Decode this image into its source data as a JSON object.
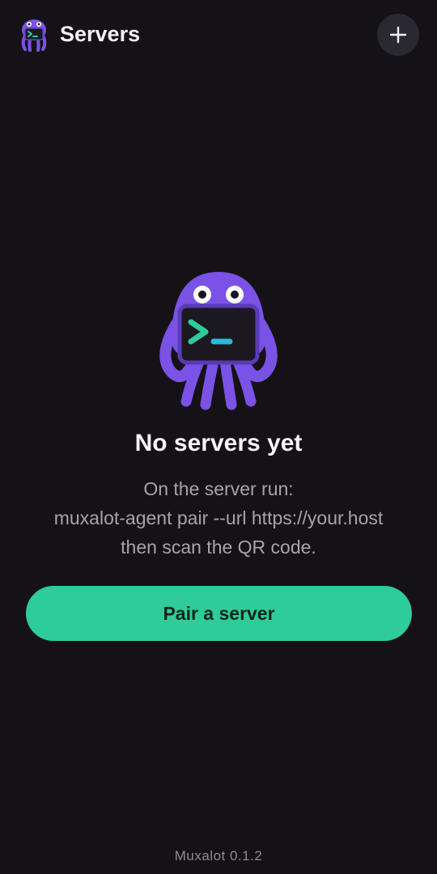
{
  "header": {
    "title": "Servers",
    "logo_icon": "octopus-terminal-logo",
    "add_icon": "plus-icon"
  },
  "empty_state": {
    "mascot_icon": "octopus-terminal-mascot",
    "title": "No servers yet",
    "description_lines": [
      "On the server run:",
      "muxalot-agent pair --url https://your.host",
      "then scan the QR code."
    ],
    "pair_button_label": "Pair a server"
  },
  "footer": {
    "version": "Muxalot 0.1.2"
  },
  "colors": {
    "background": "#141217",
    "accent_purple": "#7b52e6",
    "accent_green": "#2ecc99",
    "button_surface": "#2a2830"
  }
}
